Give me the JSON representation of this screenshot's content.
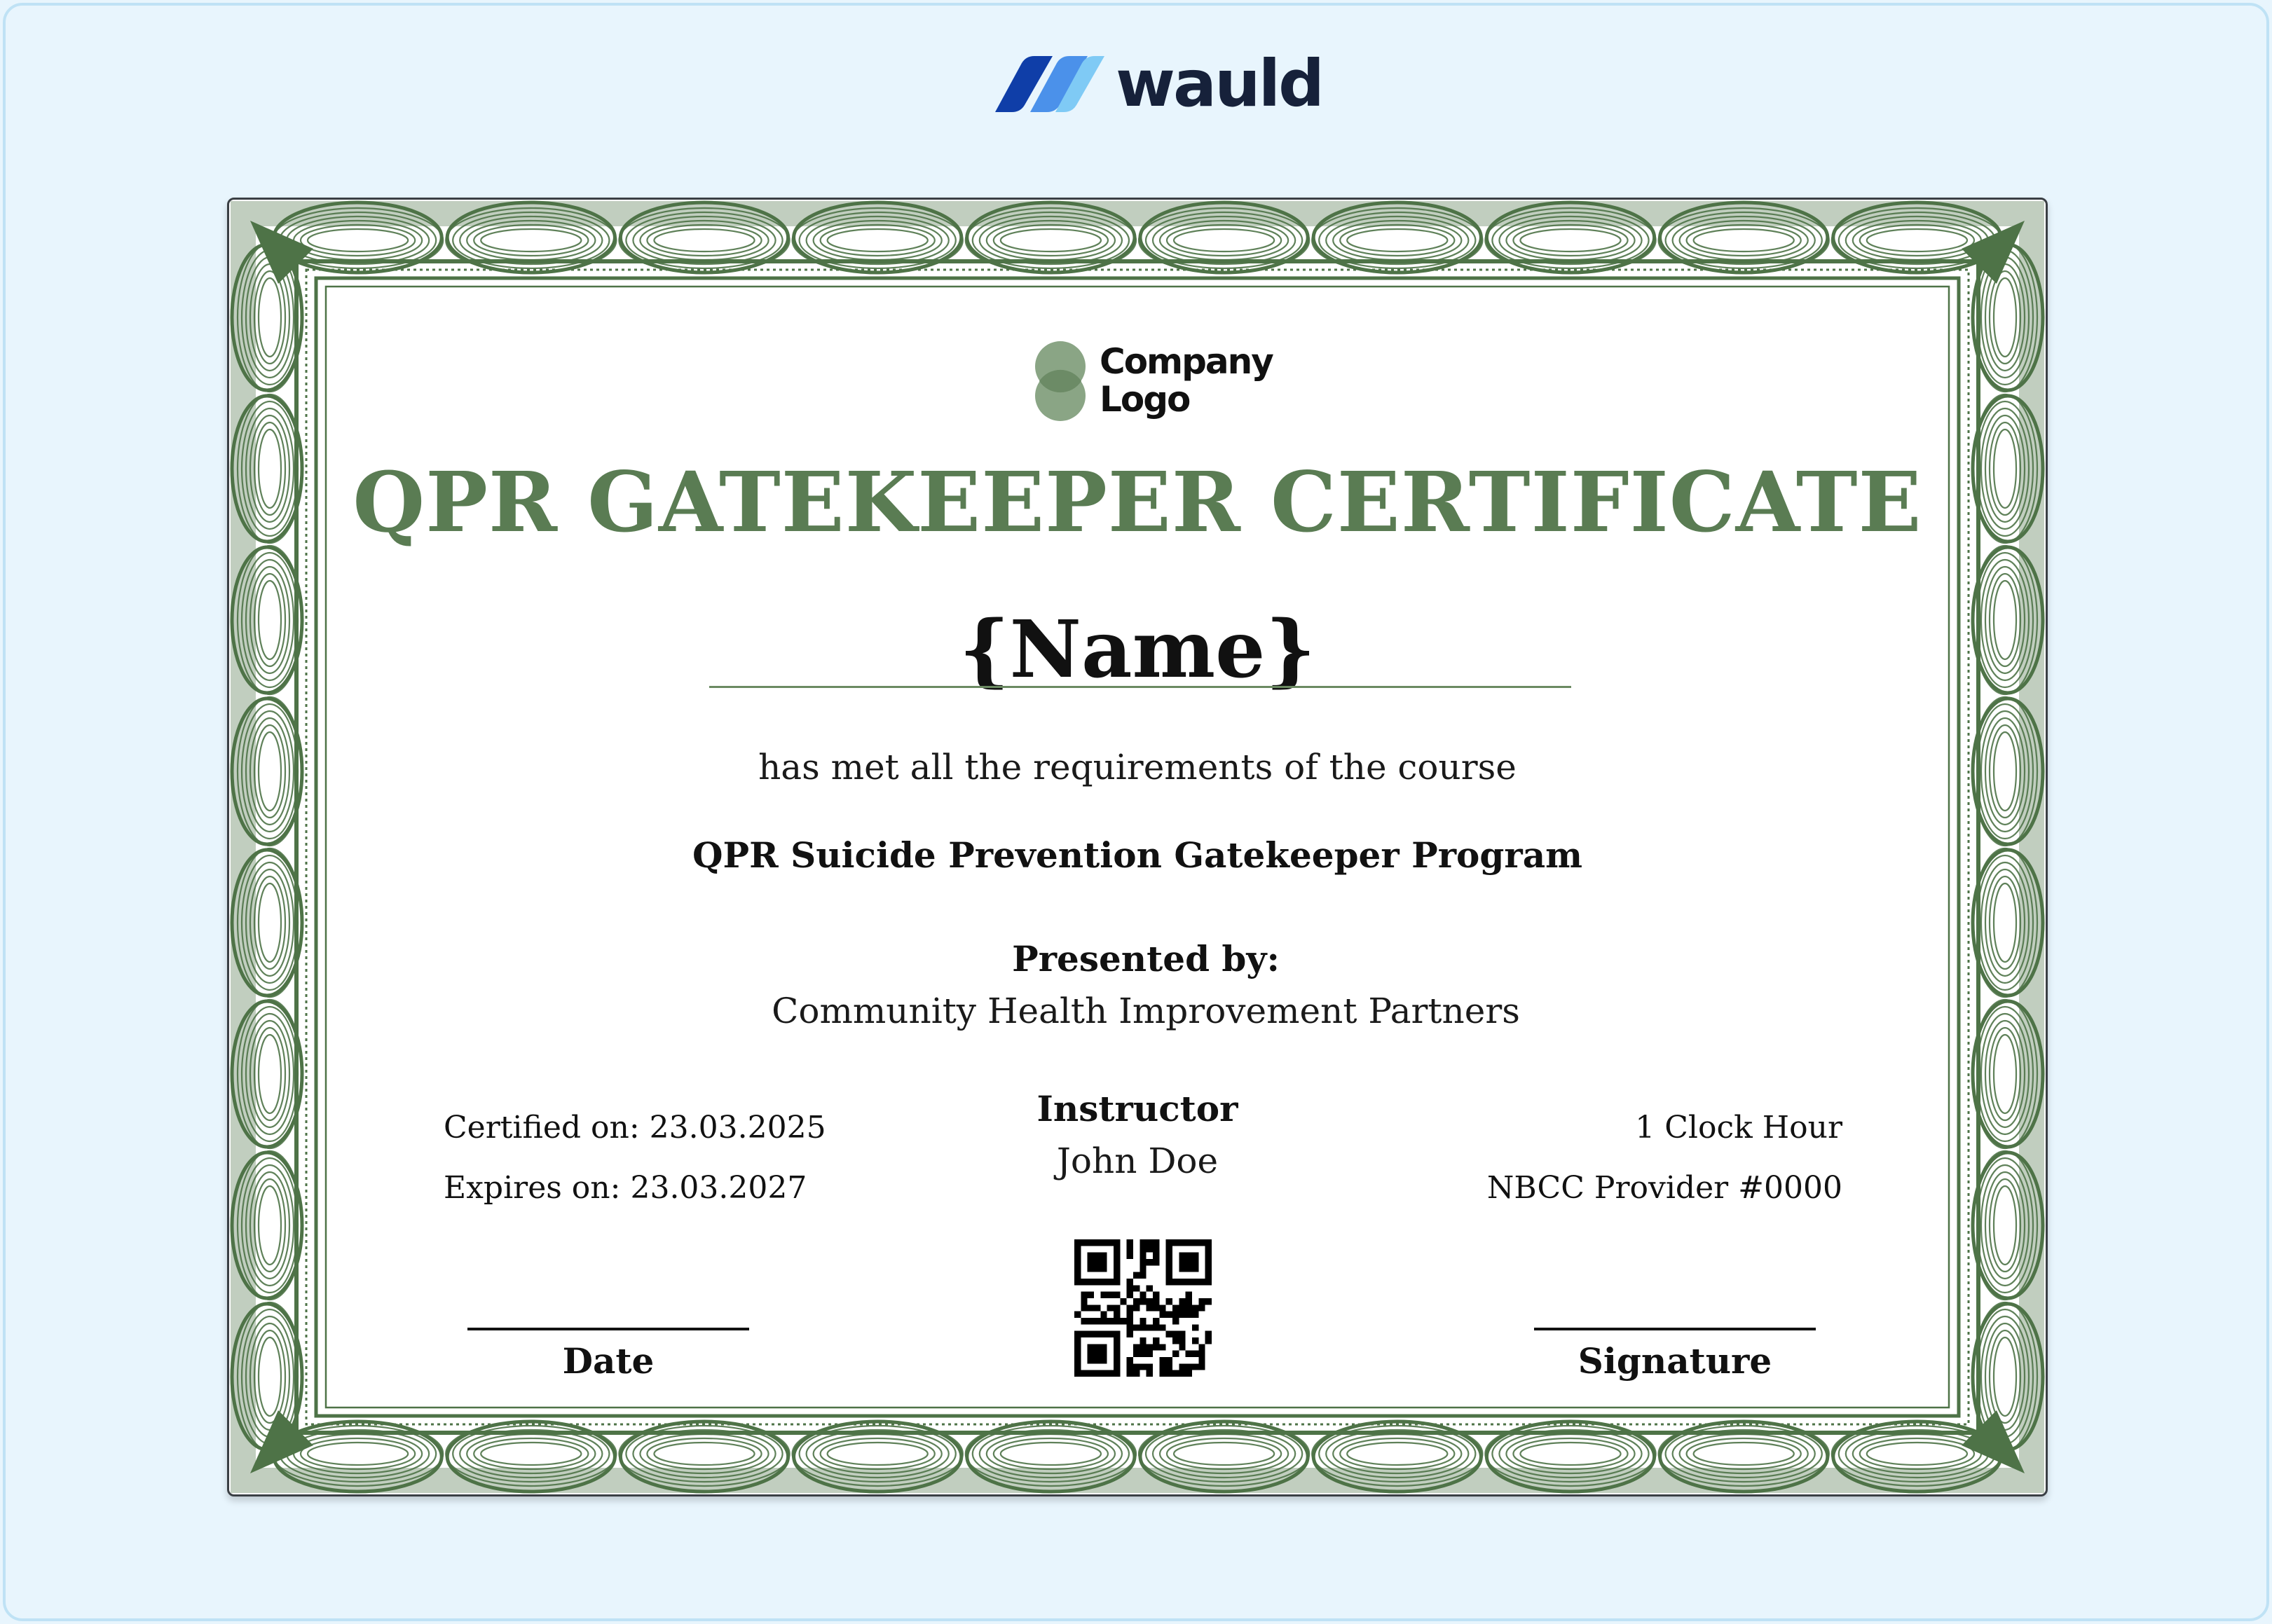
{
  "brand": {
    "name": "wauld",
    "colors": {
      "dark": "#0f3ea8",
      "light": "#7fcaf5"
    }
  },
  "certificate": {
    "logo_text": [
      "Company",
      "Logo"
    ],
    "title": "QPR GATEKEEPER CERTIFICATE",
    "recipient_name": "{Name}",
    "requirement_text": "has met all the requirements of the course",
    "course_name": "QPR Suicide Prevention Gatekeeper Program",
    "presented_by_label": "Presented by:",
    "presenter": "Community Health Improvement Partners",
    "certified_on": "Certified on: 23.03.2025",
    "expires_on": "Expires on: 23.03.2027",
    "instructor_label": "Instructor",
    "instructor_name": "John Doe",
    "credit_hours": "1 Clock Hour",
    "provider": "NBCC Provider #0000",
    "date_label": "Date",
    "signature_label": "Signature",
    "accent_color": "#5a7c53",
    "border_color": "#4e7347"
  }
}
